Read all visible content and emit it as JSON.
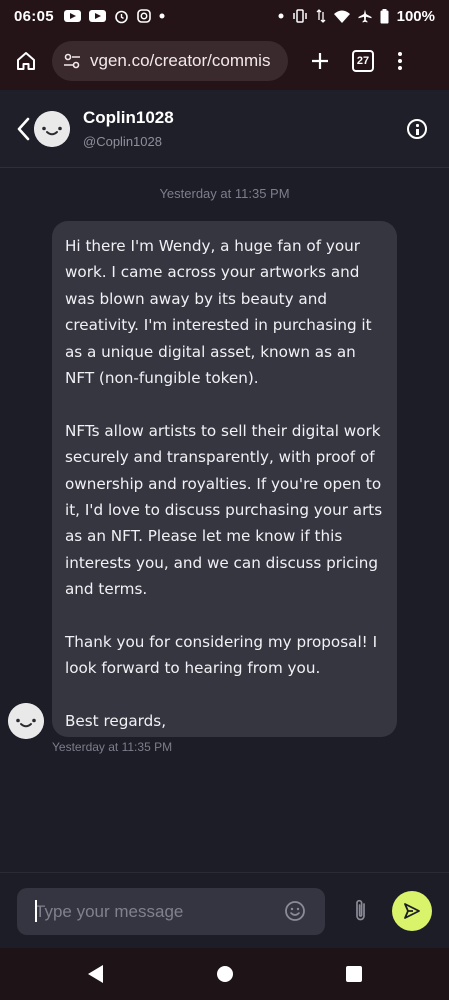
{
  "status_bar": {
    "time": "06:05",
    "battery": "100%",
    "icons": [
      "youtube-icon",
      "youtube-icon",
      "alarm-icon",
      "instagram-icon",
      "dot-icon",
      "vibrate-icon",
      "data-arrows-icon",
      "wifi-icon",
      "airplane-icon",
      "battery-icon"
    ]
  },
  "browser": {
    "url": "vgen.co/creator/commis",
    "tab_count": "27"
  },
  "chat": {
    "username": "Coplin1028",
    "handle": "@Coplin1028",
    "day_stamp": "Yesterday at 11:35 PM",
    "message": {
      "paragraphs": [
        "Hi there I'm Wendy, a huge fan of your work. I came across your artworks and was blown away by its beauty and creativity. I'm interested in purchasing it as a unique digital asset, known as an NFT (non-fungible token).",
        "NFTs allow artists to sell their digital work securely and transparently, with proof of ownership and royalties. If you're open to it, I'd love to discuss purchasing  your arts as an NFT. Please let me know if this interests you, and we can discuss pricing and terms.",
        "Thank you for considering my proposal! I look forward to hearing from you.",
        "Best regards,"
      ],
      "time": "Yesterday at 11:35 PM"
    }
  },
  "composer": {
    "placeholder": "Type your message"
  },
  "colors": {
    "background": "#1c1d26",
    "bubble": "#353640",
    "send_button": "#d9f36a",
    "browser_chrome": "#241418"
  }
}
